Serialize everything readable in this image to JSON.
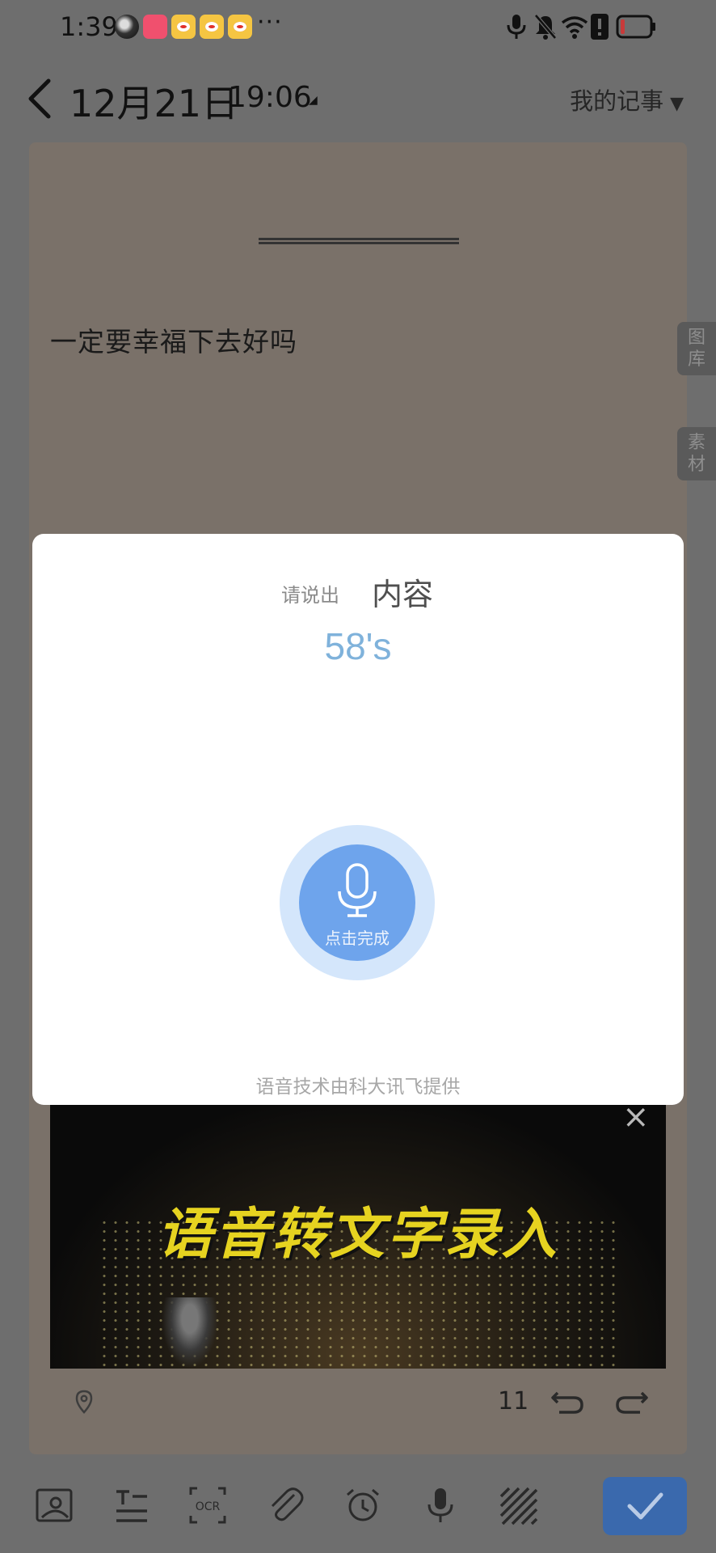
{
  "status_bar": {
    "time": "1:39",
    "more": "···",
    "icons": [
      "avatar-icon",
      "shop-icon",
      "weibo-icon",
      "weibo-icon",
      "weibo-icon",
      "mic-icon",
      "bell-off-icon",
      "wifi-icon",
      "alert-icon",
      "battery-icon"
    ]
  },
  "header": {
    "date": "12月21日",
    "time": "19:06",
    "notebook": "我的记事",
    "notebook_caret": "▼",
    "time_caret": "◢"
  },
  "note": {
    "text": "一定要幸福下去好吗",
    "side_tabs": {
      "gallery": "图\n库",
      "material": "素\n材"
    },
    "word_count": "11"
  },
  "ad": {
    "title": "语音转文字录入",
    "close": "×"
  },
  "voice_dialog": {
    "prompt_label": "请说出",
    "prompt_word": "内容",
    "countdown": "58's",
    "mic_label": "点击完成",
    "credit": "语音技术由科大讯飞提供"
  },
  "toolbar": {
    "items": [
      "image-icon",
      "text-format-icon",
      "ocr-icon",
      "attachment-icon",
      "alarm-icon",
      "mic-icon",
      "pattern-icon"
    ],
    "ocr_label": "OCR"
  },
  "colors": {
    "confirm": "#3a69ad",
    "mic_outer": "#d4e6fb",
    "mic_inner": "#6ea4ec",
    "countdown": "#7fb2db",
    "ad_title": "#e6d320"
  }
}
